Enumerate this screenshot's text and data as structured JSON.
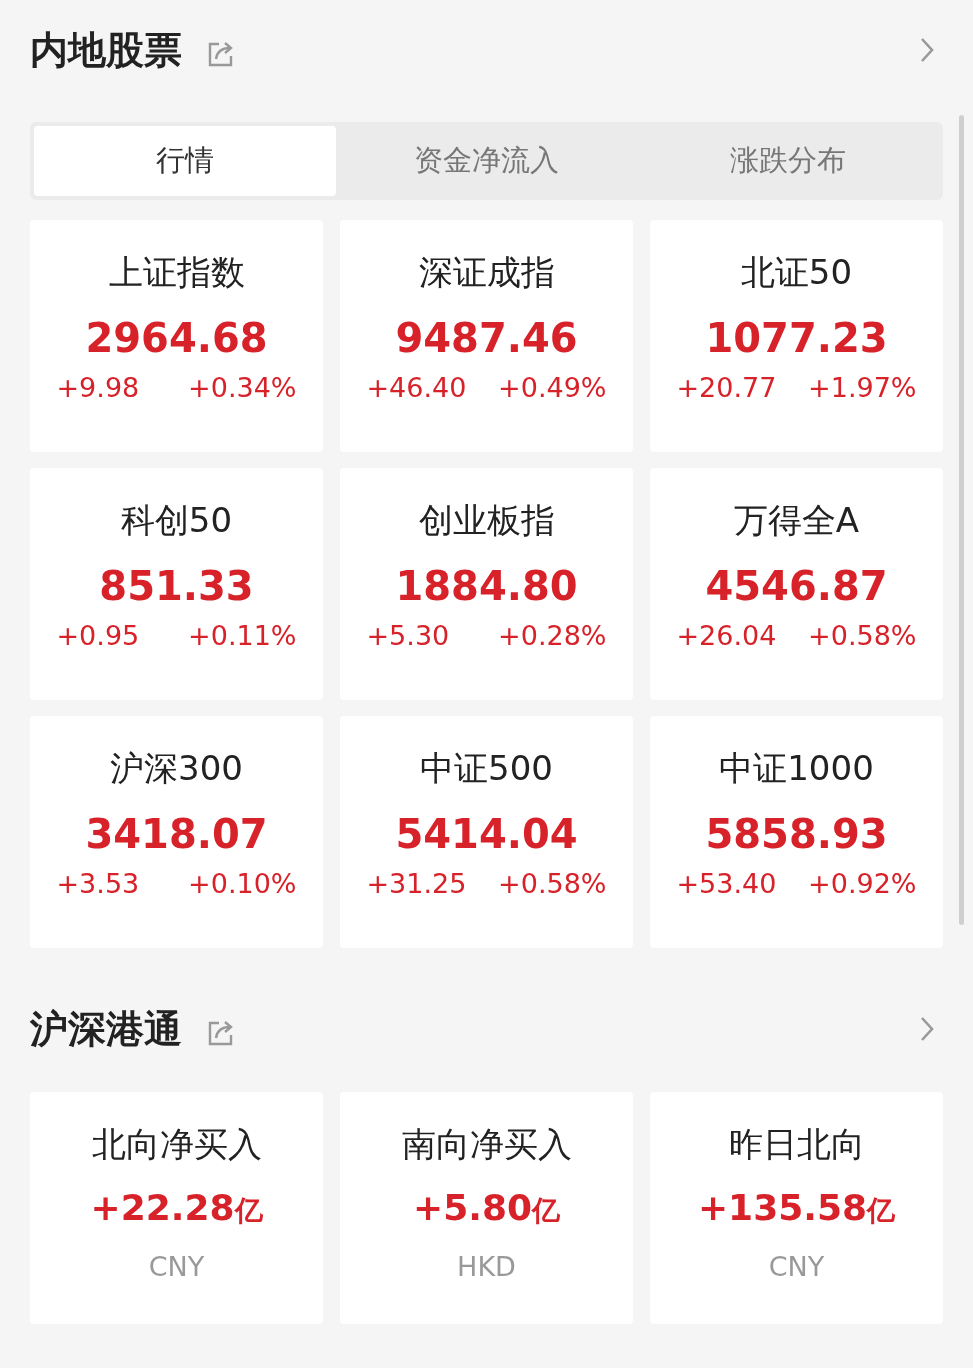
{
  "sections": [
    {
      "title": "内地股票",
      "tabs": [
        {
          "label": "行情",
          "selected": true
        },
        {
          "label": "资金净流入",
          "selected": false
        },
        {
          "label": "涨跌分布",
          "selected": false
        }
      ],
      "cards": [
        {
          "kind": "index",
          "name": "上证指数",
          "value": "2964.68",
          "change": "+9.98",
          "percent": "+0.34%"
        },
        {
          "kind": "index",
          "name": "深证成指",
          "value": "9487.46",
          "change": "+46.40",
          "percent": "+0.49%"
        },
        {
          "kind": "index",
          "name": "北证50",
          "value": "1077.23",
          "change": "+20.77",
          "percent": "+1.97%"
        },
        {
          "kind": "index",
          "name": "科创50",
          "value": "851.33",
          "change": "+0.95",
          "percent": "+0.11%"
        },
        {
          "kind": "index",
          "name": "创业板指",
          "value": "1884.80",
          "change": "+5.30",
          "percent": "+0.28%"
        },
        {
          "kind": "index",
          "name": "万得全A",
          "value": "4546.87",
          "change": "+26.04",
          "percent": "+0.58%"
        },
        {
          "kind": "index",
          "name": "沪深300",
          "value": "3418.07",
          "change": "+3.53",
          "percent": "+0.10%"
        },
        {
          "kind": "index",
          "name": "中证500",
          "value": "5414.04",
          "change": "+31.25",
          "percent": "+0.58%"
        },
        {
          "kind": "index",
          "name": "中证1000",
          "value": "5858.93",
          "change": "+53.40",
          "percent": "+0.92%"
        }
      ]
    },
    {
      "title": "沪深港通",
      "cards": [
        {
          "kind": "flow",
          "name": "北向净买入",
          "value": "+22.28",
          "unit": "亿",
          "currency": "CNY"
        },
        {
          "kind": "flow",
          "name": "南向净买入",
          "value": "+5.80",
          "unit": "亿",
          "currency": "HKD"
        },
        {
          "kind": "flow",
          "name": "昨日北向",
          "value": "+135.58",
          "unit": "亿",
          "currency": "CNY"
        }
      ]
    }
  ]
}
